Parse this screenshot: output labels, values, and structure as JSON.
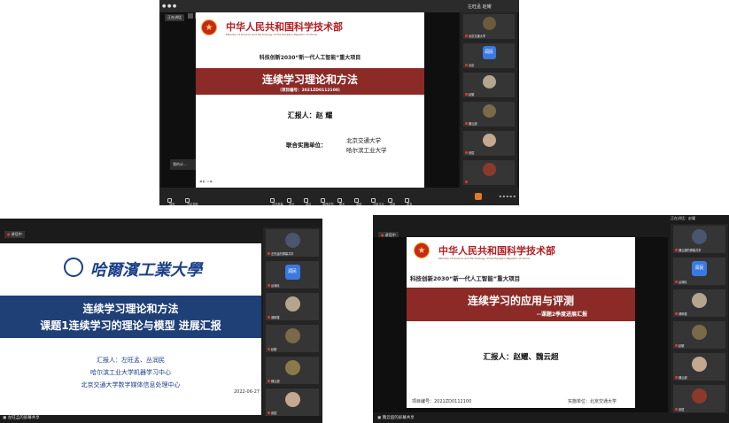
{
  "top_meeting": {
    "topbar": {
      "rec_label": "正在讲话",
      "speaker_label": "左旺孟 赵耀"
    },
    "slide": {
      "ministry_cn": "中华人民共和国科学技术部",
      "ministry_en": "Ministry of Science and Technology of the People's Republic of China",
      "project": "科技创新2030“新一代人工智能”重大项目",
      "title": "连续学习理论和方法",
      "project_no": "（项目编号：2021ZD0112100）",
      "reporter": "汇报人：赵 耀",
      "unit_label": "联合实施单位：",
      "unit_1": "北京交通大学",
      "unit_2": "哈尔滨工业大学"
    },
    "overlay_name": "我的计...",
    "participants": [
      {
        "name": "北京交通大学",
        "avatar_color": "#6b5b3a"
      },
      {
        "name": "北京",
        "avatar_color": "#3a79e0",
        "avatar_text": "润民"
      },
      {
        "name": "赵耀",
        "avatar_color": "#b4a58e"
      },
      {
        "name": "魏云超",
        "avatar_color": "#7a6a4a"
      },
      {
        "name": "张斌",
        "avatar_color": "#c4a890"
      },
      {
        "name": "",
        "avatar_color": "#8a3a2a"
      }
    ],
    "toolbar": {
      "left": [
        "静音",
        "开启视频"
      ],
      "center": [
        "共享屏幕",
        "安全",
        "邀请",
        "管理成员",
        "聊天",
        "录制",
        "分组讨论",
        "应用",
        "更多"
      ]
    }
  },
  "left_meeting": {
    "topbar": {
      "rec_label": "讲话中"
    },
    "slide": {
      "university": "哈爾濱工業大學",
      "title_line1": "连续学习理论和方法",
      "title_line2": "课题1连续学习的理论与模型  进展汇报",
      "reporter": "汇报人：左旺孟、丛润民",
      "unit_1": "哈尔滨工业大学机器学习中心",
      "unit_2": "北京交通大学数字媒体信息处理中心",
      "date": "2022-06-27"
    },
    "participants": [
      {
        "name": "左旺孟的屏幕共享",
        "avatar_color": "#4a5570"
      },
      {
        "name": "丛润民",
        "avatar_color": "#3a79e0",
        "avatar_text": "润民"
      },
      {
        "name": "调研楼",
        "avatar_color": "#b4a58e"
      },
      {
        "name": "赵耀",
        "avatar_color": "#7a6a4a"
      },
      {
        "name": "魏云超",
        "avatar_color": "#8a7a4a"
      },
      {
        "name": "张斌",
        "avatar_color": "#c4a890"
      }
    ],
    "share_label": "左旺孟的屏幕共享"
  },
  "right_meeting": {
    "topbar": {
      "rec_label": "讲话中",
      "speaker_label": "正在讲话：赵耀"
    },
    "slide": {
      "ministry_cn": "中华人民共和国科学技术部",
      "ministry_en": "Ministry of Science and Technology of the People's Republic of China",
      "project": "科技创新2030“新一代人工智能”重大项目",
      "title": "连续学习的应用与评测",
      "subtitle": "--课题2季度进展汇报",
      "reporter": "汇报人：赵耀、魏云超",
      "project_no": "项目编号：2021ZD0112100",
      "unit": "实施单位：北京交通大学"
    },
    "participants": [
      {
        "name": "魏云超的屏幕共享",
        "avatar_color": "#4a5570"
      },
      {
        "name": "丛润民",
        "avatar_color": "#3a79e0",
        "avatar_text": "润民"
      },
      {
        "name": "调研楼",
        "avatar_color": "#b4a58e"
      },
      {
        "name": "赵耀",
        "avatar_color": "#7a6a4a"
      },
      {
        "name": "魏云超",
        "avatar_color": "#c4a890"
      },
      {
        "name": "张斌",
        "avatar_color": "#8a3a2a"
      }
    ],
    "share_label": "魏云超的屏幕共享"
  },
  "colors": {
    "red_band": "#8b2a26",
    "blue_band": "#1f3f77",
    "blue_text": "#1a3f8a",
    "zoom_blue": "#3a79e0"
  }
}
